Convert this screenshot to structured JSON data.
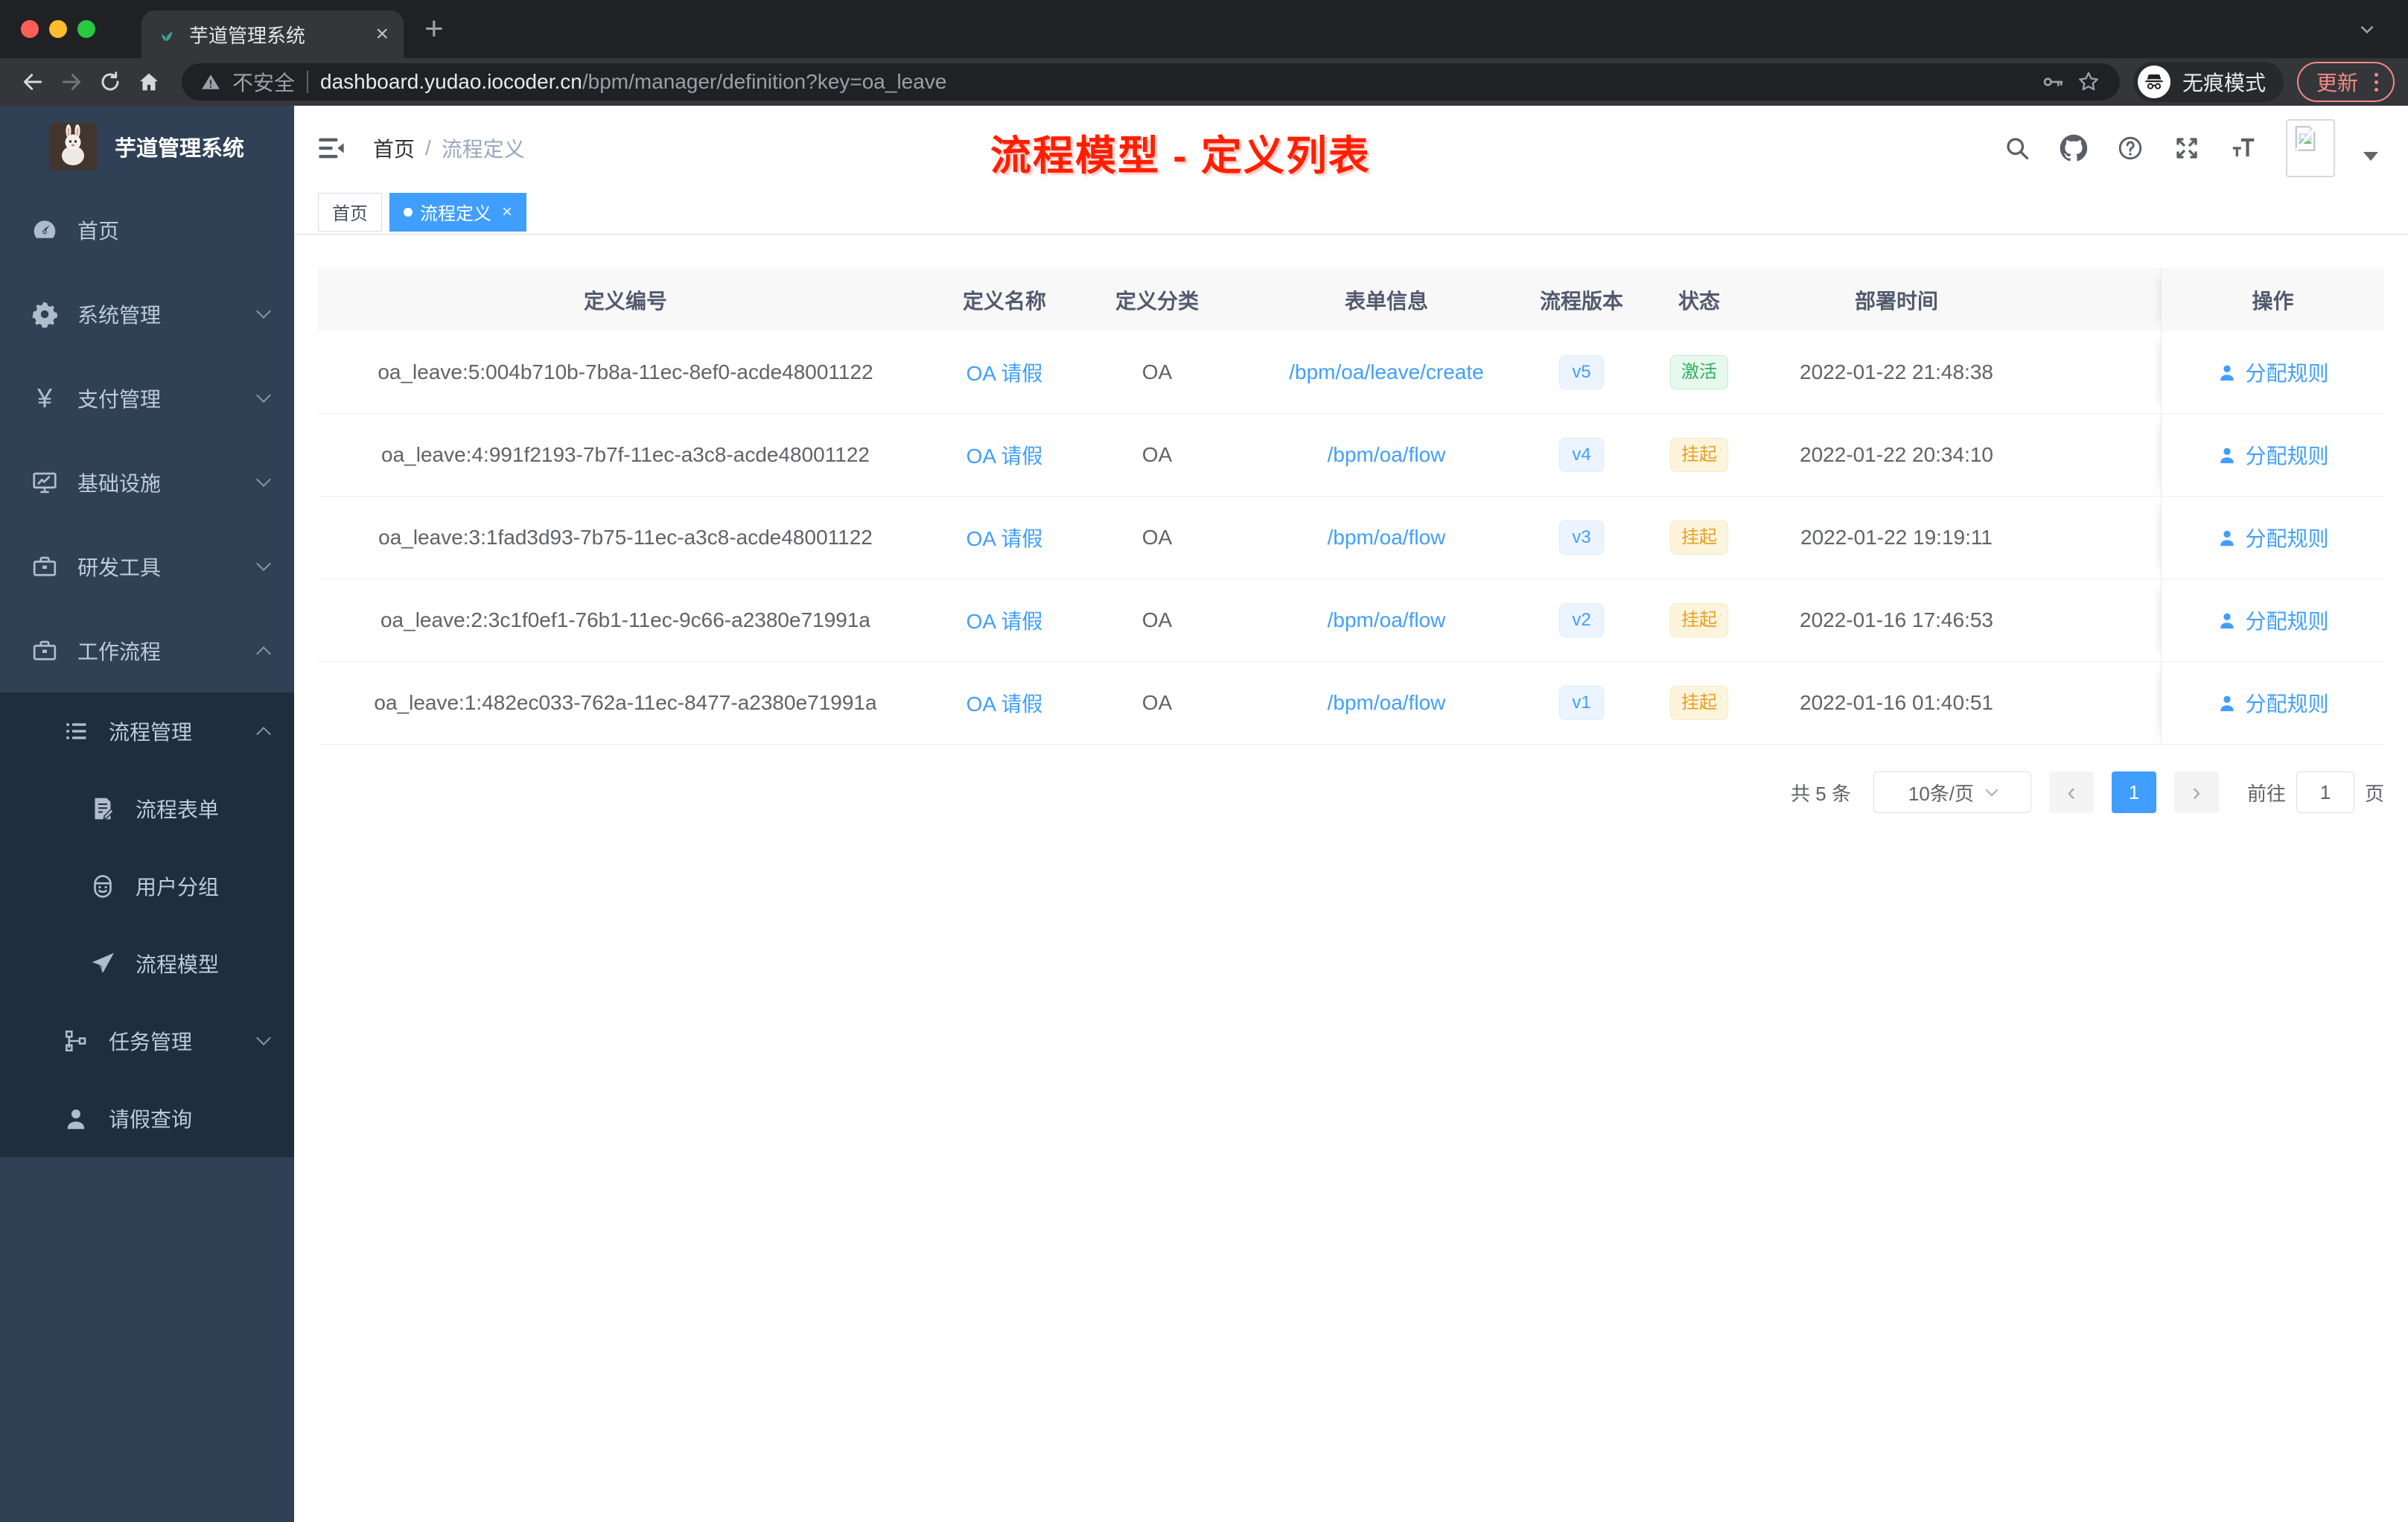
{
  "browser": {
    "tab": {
      "title": "芋道管理系统",
      "close_glyph": "×",
      "new_tab_glyph": "+"
    },
    "address": {
      "security": "不安全",
      "host": "dashboard.yudao.iocoder.cn",
      "path": "/bpm/manager/definition?key=oa_leave"
    },
    "incognito_label": "无痕模式",
    "update_label": "更新"
  },
  "header": {
    "logo_title": "芋道管理系统",
    "breadcrumb": {
      "home": "首页",
      "separator": "/",
      "current": "流程定义"
    },
    "annotation": "流程模型 - 定义列表"
  },
  "tags": {
    "home": "首页",
    "active": "流程定义",
    "close_glyph": "×"
  },
  "sidebar": {
    "items": [
      {
        "label": "首页",
        "icon": "dashboard-icon",
        "class": "level1",
        "chevron_class": "chev-none"
      },
      {
        "label": "系统管理",
        "icon": "gear-icon",
        "class": "level1",
        "chevron_class": "chev-down"
      },
      {
        "label": "支付管理",
        "icon": "yen-icon",
        "class": "level1",
        "chevron_class": "chev-down"
      },
      {
        "label": "基础设施",
        "icon": "monitor-icon",
        "class": "level1",
        "chevron_class": "chev-down"
      },
      {
        "label": "研发工具",
        "icon": "toolbox-icon",
        "class": "level1",
        "chevron_class": "chev-down"
      },
      {
        "label": "工作流程",
        "icon": "briefcase-icon",
        "class": "level1",
        "chevron_class": "chev-up"
      },
      {
        "label": "流程管理",
        "icon": "list-tree-icon",
        "class": "level2 dark",
        "chevron_class": "chev-up"
      },
      {
        "label": "流程表单",
        "icon": "form-doc-icon",
        "class": "level3 dark",
        "chevron_class": "chev-none"
      },
      {
        "label": "用户分组",
        "icon": "robot-icon",
        "class": "level3 dark",
        "chevron_class": "chev-none"
      },
      {
        "label": "流程模型",
        "icon": "paper-plane-icon",
        "class": "level3 dark",
        "chevron_class": "chev-none"
      },
      {
        "label": "任务管理",
        "icon": "org-tree-icon",
        "class": "level2 dark",
        "chevron_class": "chev-down"
      },
      {
        "label": "请假查询",
        "icon": "user-icon",
        "class": "level2 dark",
        "chevron_class": "chev-none"
      }
    ]
  },
  "table": {
    "columns": [
      "定义编号",
      "定义名称",
      "定义分类",
      "表单信息",
      "流程版本",
      "状态",
      "部署时间",
      "操作"
    ],
    "rows": [
      {
        "id": "oa_leave:5:004b710b-7b8a-11ec-8ef0-acde48001122",
        "name": "OA 请假",
        "category": "OA",
        "form": "/bpm/oa/leave/create",
        "version": "v5",
        "status": "激活",
        "status_class": "success",
        "time": "2022-01-22 21:48:38",
        "action": "分配规则"
      },
      {
        "id": "oa_leave:4:991f2193-7b7f-11ec-a3c8-acde48001122",
        "name": "OA 请假",
        "category": "OA",
        "form": "/bpm/oa/flow",
        "version": "v4",
        "status": "挂起",
        "status_class": "warning",
        "time": "2022-01-22 20:34:10",
        "action": "分配规则"
      },
      {
        "id": "oa_leave:3:1fad3d93-7b75-11ec-a3c8-acde48001122",
        "name": "OA 请假",
        "category": "OA",
        "form": "/bpm/oa/flow",
        "version": "v3",
        "status": "挂起",
        "status_class": "warning",
        "time": "2022-01-22 19:19:11",
        "action": "分配规则"
      },
      {
        "id": "oa_leave:2:3c1f0ef1-76b1-11ec-9c66-a2380e71991a",
        "name": "OA 请假",
        "category": "OA",
        "form": "/bpm/oa/flow",
        "version": "v2",
        "status": "挂起",
        "status_class": "warning",
        "time": "2022-01-16 17:46:53",
        "action": "分配规则"
      },
      {
        "id": "oa_leave:1:482ec033-762a-11ec-8477-a2380e71991a",
        "name": "OA 请假",
        "category": "OA",
        "form": "/bpm/oa/flow",
        "version": "v1",
        "status": "挂起",
        "status_class": "warning",
        "time": "2022-01-16 01:40:51",
        "action": "分配规则"
      }
    ]
  },
  "pagination": {
    "total": "共 5 条",
    "page_size": "10条/页",
    "prev_glyph": "‹",
    "next_glyph": "›",
    "page": "1",
    "goto_label": "前往",
    "goto_value": "1",
    "unit": "页"
  },
  "colors": {
    "accent": "#409eff",
    "sidebar_bg": "#304156",
    "submenu_bg": "#1f2d3d",
    "annotation_red": "#ff1f00",
    "success_text": "#2fae5f",
    "warning_text": "#ec9f23"
  }
}
